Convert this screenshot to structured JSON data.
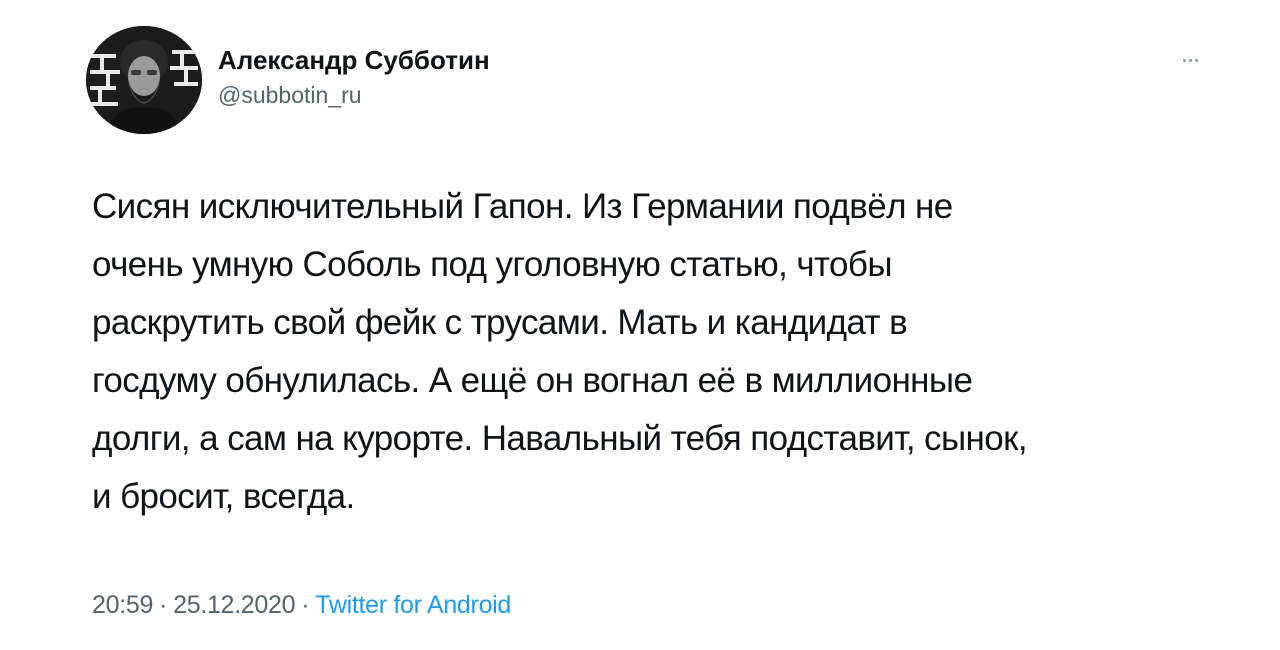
{
  "author": {
    "display_name": "Александр Субботин",
    "handle": "@subbotin_ru",
    "avatar_icon": "user-avatar-photo"
  },
  "more_icon": "more-dots-icon",
  "tweet": {
    "lines": [
      "Сисян исключительный Гапон. Из Германии подвёл не",
      "очень умную Соболь под уголовную статью, чтобы",
      "раскрутить свой фейк с трусами. Мать и кандидат в",
      "госдуму обнулилась. А ещё он вогнал её в миллионные",
      "долги, а сам на курорте. Навальный тебя подставит, сынок,",
      "и бросит, всегда."
    ]
  },
  "meta": {
    "time": "20:59",
    "separator": "·",
    "date": "25.12.2020",
    "source": "Twitter for Android"
  },
  "colors": {
    "text": "#0f1419",
    "secondary": "#536471",
    "link": "#1d9bf0"
  }
}
